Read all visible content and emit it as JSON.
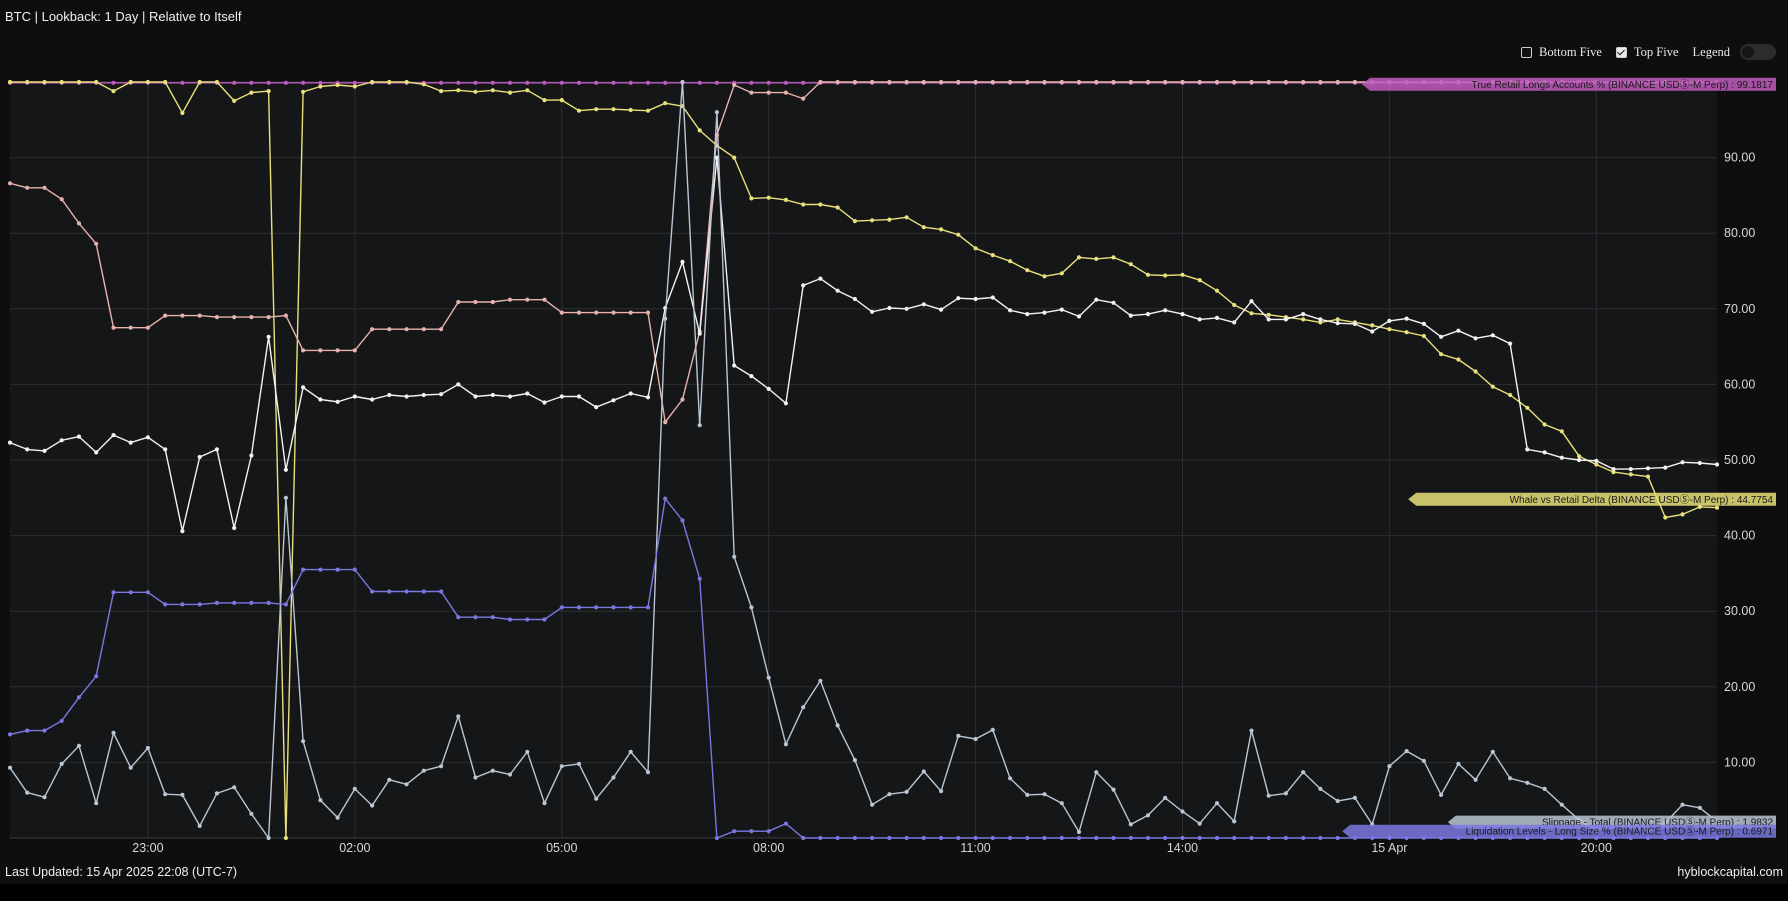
{
  "header": {
    "title": "BTC | Lookback: 1 Day | Relative to Itself"
  },
  "controls": {
    "bottom_five_label": "Bottom Five",
    "bottom_five_checked": false,
    "top_five_label": "Top Five",
    "top_five_checked": true,
    "legend_label": "Legend",
    "legend_on": false
  },
  "footer": {
    "last_updated": "Last Updated: 15 Apr 2025 22:08 (UTC-7)",
    "brand": "hyblockcapital.com"
  },
  "chart_data": {
    "type": "line",
    "title": "",
    "xlabel": "",
    "ylabel": "",
    "ylim": [
      0,
      100
    ],
    "y_ticks": [
      "10.00",
      "20.00",
      "30.00",
      "40.00",
      "50.00",
      "60.00",
      "70.00",
      "80.00",
      "90.00"
    ],
    "x_ticks": [
      {
        "t": 23.0,
        "label": "23:00"
      },
      {
        "t": 26.0,
        "label": "02:00"
      },
      {
        "t": 29.0,
        "label": "05:00"
      },
      {
        "t": 32.0,
        "label": "08:00"
      },
      {
        "t": 35.0,
        "label": "11:00"
      },
      {
        "t": 38.0,
        "label": "14:00"
      },
      {
        "t": 41.0,
        "label": "15 Apr"
      },
      {
        "t": 44.0,
        "label": "20:00"
      }
    ],
    "grid": true,
    "x_range": [
      21.0,
      45.75
    ],
    "x_step": 0.25,
    "series": [
      {
        "name": "True Retail Longs Accounts % (BINANCE USDⓈ-M Perp)",
        "color": "#c05cc0",
        "label_text": "True Retail Longs Accounts % (BINANCE USDⓈ-M Perp) : 99.1817",
        "label_value": 99.7,
        "values": [
          99.9,
          99.9,
          99.9,
          99.9,
          99.9,
          99.9,
          99.9,
          99.9,
          99.9,
          99.9,
          99.9,
          99.9,
          99.9,
          99.9,
          99.9,
          99.9,
          99.9,
          99.9,
          99.9,
          99.9,
          99.9,
          99.9,
          99.9,
          99.9,
          99.9,
          99.9,
          99.9,
          99.9,
          99.9,
          99.9,
          99.9,
          99.9,
          99.9,
          99.9,
          99.9,
          99.9,
          99.9,
          99.9,
          99.9,
          99.9,
          99.9,
          99.9,
          99.9,
          99.9,
          99.9,
          99.9,
          99.9,
          99.9,
          99.9,
          99.9,
          99.9,
          99.9,
          99.9,
          99.9,
          99.9,
          99.9,
          99.9,
          99.9,
          99.9,
          99.9,
          99.9,
          99.9,
          99.9,
          99.9,
          99.9,
          99.9,
          99.9,
          99.9,
          99.9,
          99.9,
          99.9,
          99.9,
          99.9,
          99.9,
          99.9,
          99.9,
          99.9,
          99.9,
          99.9,
          99.9,
          99.9,
          99.9,
          99.9,
          99.9,
          99.9,
          99.9,
          99.9,
          99.9,
          99.9,
          99.9,
          99.9,
          99.9,
          99.9,
          99.9,
          99.9,
          99.9,
          99.9,
          99.9,
          99.9,
          99.9
        ]
      },
      {
        "name": "Whale vs Retail Delta (BINANCE USDⓈ-M Perp)",
        "color": "#e8e07a",
        "label_text": "Whale vs Retail Delta (BINANCE USDⓈ-M Perp) : 44.7754",
        "label_value": 44.8,
        "values": [
          100,
          100,
          100,
          100,
          100,
          100,
          98.8,
          100,
          100,
          100,
          95.9,
          100,
          100,
          97.5,
          98.6,
          98.8,
          0,
          98.7,
          99.4,
          99.6,
          99.4,
          100,
          100,
          100,
          99.7,
          98.8,
          98.9,
          98.7,
          98.9,
          98.6,
          98.9,
          97.6,
          97.6,
          96.2,
          96.4,
          96.4,
          96.3,
          96.2,
          97.2,
          96.8,
          93.6,
          91.6,
          90,
          84.6,
          84.7,
          84.4,
          83.8,
          83.8,
          83.4,
          81.6,
          81.7,
          81.8,
          82.1,
          80.8,
          80.5,
          79.8,
          78,
          77.1,
          76.3,
          75.1,
          74.3,
          74.7,
          76.8,
          76.6,
          76.8,
          75.9,
          74.5,
          74.4,
          74.5,
          73.8,
          72.4,
          70.5,
          69.4,
          69.2,
          68.9,
          68.6,
          68.2,
          68.6,
          68.2,
          67.8,
          67.3,
          66.9,
          66.4,
          64,
          63.3,
          61.7,
          59.7,
          58.6,
          56.9,
          54.7,
          53.8,
          50.5,
          49.4,
          48.4,
          48.1,
          47.8,
          42.4,
          42.8,
          43.8,
          43.7
        ]
      },
      {
        "name": "",
        "color": "#e7b2ae",
        "values": [
          86.6,
          86.0,
          86.0,
          84.5,
          81.3,
          78.6,
          67.5,
          67.5,
          67.5,
          69.1,
          69.1,
          69.1,
          68.9,
          68.9,
          68.9,
          68.9,
          69.1,
          64.5,
          64.5,
          64.5,
          64.5,
          67.3,
          67.3,
          67.3,
          67.3,
          67.3,
          70.9,
          70.9,
          70.9,
          71.2,
          71.2,
          71.2,
          69.5,
          69.5,
          69.5,
          69.5,
          69.5,
          69.5,
          55.0,
          58.0,
          67.0,
          93.0,
          99.6,
          98.6,
          98.6,
          98.6,
          97.8,
          100,
          100,
          100,
          100,
          100,
          100,
          100,
          100,
          100,
          100,
          100,
          100,
          100,
          100,
          100,
          100,
          100,
          100,
          100,
          100,
          100,
          100,
          100,
          100,
          100,
          100,
          100,
          100,
          100,
          100,
          100,
          100,
          100,
          100,
          100,
          100,
          100,
          100,
          100,
          100,
          100,
          100,
          100,
          100,
          100,
          100,
          100,
          100,
          100,
          100,
          100,
          100,
          100
        ]
      },
      {
        "name": "",
        "color": "#f2f2f2",
        "values": [
          52.3,
          51.4,
          51.2,
          52.6,
          53.1,
          51.0,
          53.3,
          52.3,
          53.0,
          51.4,
          40.6,
          50.4,
          51.4,
          41.0,
          50.6,
          66.3,
          48.7,
          59.6,
          58.0,
          57.7,
          58.4,
          58.0,
          58.6,
          58.4,
          58.6,
          58.7,
          60.0,
          58.4,
          58.6,
          58.4,
          58.8,
          57.6,
          58.4,
          58.4,
          57.0,
          57.9,
          58.8,
          58.3,
          70.1,
          76.2,
          66.7,
          90.0,
          62.5,
          61.1,
          59.4,
          57.5,
          73.1,
          74.0,
          72.4,
          71.3,
          69.6,
          70.1,
          70.0,
          70.6,
          69.9,
          71.4,
          71.3,
          71.5,
          69.8,
          69.3,
          69.5,
          69.9,
          69.0,
          71.2,
          70.8,
          69.1,
          69.3,
          69.8,
          69.3,
          68.6,
          68.8,
          68.2,
          71.0,
          68.6,
          68.6,
          69.3,
          68.6,
          68.1,
          68.0,
          67.0,
          68.4,
          68.7,
          68.0,
          66.3,
          67.1,
          66.1,
          66.5,
          65.4,
          51.4,
          51.0,
          50.3,
          50.0,
          49.9,
          48.8,
          48.8,
          48.9,
          49.0,
          49.7,
          49.6,
          49.4
        ]
      },
      {
        "name": "Slippage - Total (BINANCE USDⓈ-M Perp)",
        "color": "#b9c6d4",
        "label_text": "Slippage - Total (BINANCE USDⓈ-M Perp) : 1.9832",
        "label_value": 2.1,
        "values": [
          9.3,
          6.0,
          5.4,
          9.8,
          12.2,
          4.6,
          13.9,
          9.3,
          11.9,
          5.8,
          5.7,
          1.6,
          5.9,
          6.7,
          3.2,
          0,
          45.0,
          12.8,
          5.0,
          2.7,
          6.5,
          4.3,
          7.7,
          7.1,
          8.9,
          9.5,
          16.1,
          8.0,
          8.9,
          8.4,
          11.4,
          4.6,
          9.5,
          9.8,
          5.2,
          8.0,
          11.4,
          8.7,
          68.7,
          100,
          54.6,
          96.0,
          37.2,
          30.5,
          21.2,
          12.4,
          17.3,
          20.8,
          14.9,
          10.3,
          4.4,
          5.8,
          6.1,
          8.8,
          6.2,
          13.5,
          13.1,
          14.3,
          7.9,
          5.7,
          5.8,
          4.6,
          0.8,
          8.7,
          6.4,
          1.8,
          3.0,
          5.3,
          3.5,
          1.9,
          4.6,
          2.2,
          14.2,
          5.6,
          5.9,
          8.7,
          6.5,
          4.9,
          5.3,
          1.8,
          9.5,
          11.5,
          10.2,
          5.7,
          9.8,
          7.7,
          11.4,
          7.9,
          7.3,
          6.5,
          4.4,
          2.4,
          1.0,
          1.5,
          1.4,
          0.9,
          2.0,
          4.4,
          4.0,
          2.2
        ]
      },
      {
        "name": "Liquidation Levels - Long Size % (BINANCE USDⓈ-M Perp)",
        "color": "#7a78e0",
        "label_text": "Liquidation Levels - Long Size % (BINANCE USDⓈ-M Perp) : 0.6971",
        "label_value": 0.9,
        "values": [
          13.7,
          14.2,
          14.2,
          15.5,
          18.6,
          21.4,
          32.5,
          32.5,
          32.5,
          30.9,
          30.9,
          30.9,
          31.1,
          31.1,
          31.1,
          31.1,
          30.9,
          35.5,
          35.5,
          35.5,
          35.5,
          32.6,
          32.6,
          32.6,
          32.6,
          32.6,
          29.2,
          29.2,
          29.2,
          28.9,
          28.9,
          28.9,
          30.5,
          30.5,
          30.5,
          30.5,
          30.5,
          30.5,
          44.9,
          42.0,
          34.3,
          0,
          0.9,
          0.9,
          0.9,
          1.9,
          0,
          0,
          0,
          0,
          0,
          0,
          0,
          0,
          0,
          0,
          0,
          0,
          0,
          0,
          0,
          0,
          0,
          0,
          0,
          0,
          0,
          0,
          0,
          0,
          0,
          0,
          0,
          0,
          0,
          0,
          0,
          0,
          0,
          0,
          0,
          0,
          0,
          0,
          0,
          0,
          0,
          0,
          0,
          0,
          0,
          0,
          0,
          0,
          0,
          0,
          0,
          0,
          0,
          0
        ]
      }
    ]
  }
}
